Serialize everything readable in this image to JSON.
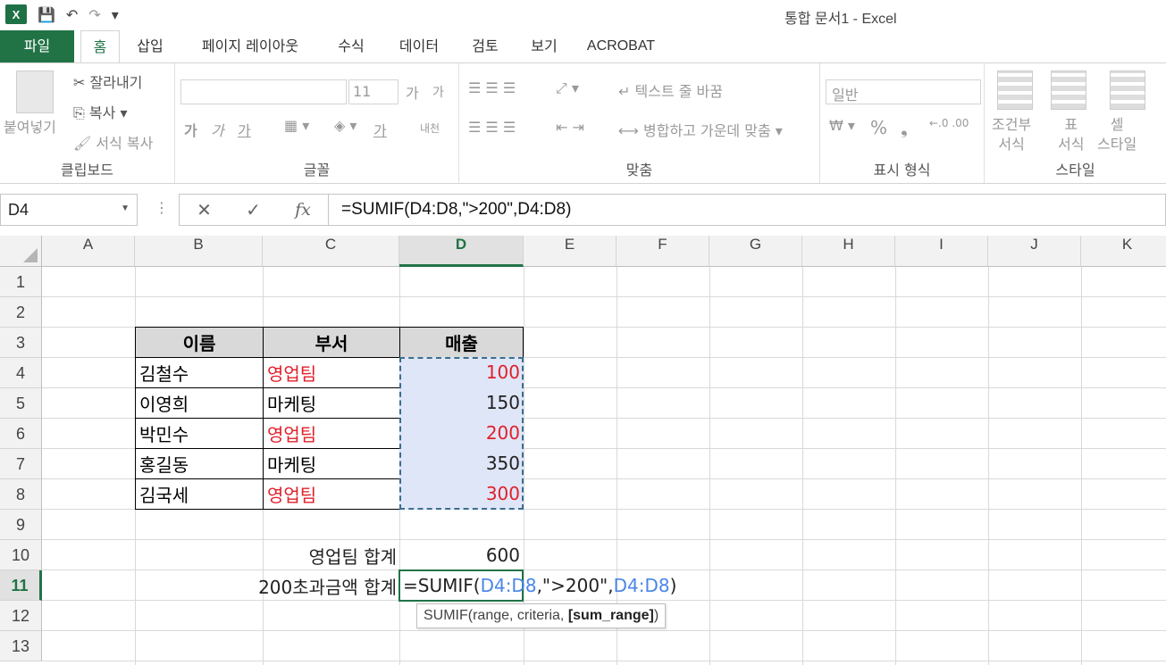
{
  "window": {
    "title": "통합 문서1 - Excel"
  },
  "qat": {
    "excel_logo": "X",
    "save_icon": "💾",
    "undo_icon": "↶",
    "redo_icon": "↷",
    "more_icon": "▾"
  },
  "tabs": [
    {
      "label": "파일"
    },
    {
      "label": "홈"
    },
    {
      "label": "삽입"
    },
    {
      "label": "페이지 레이아웃"
    },
    {
      "label": "수식"
    },
    {
      "label": "데이터"
    },
    {
      "label": "검토"
    },
    {
      "label": "보기"
    },
    {
      "label": "ACROBAT"
    }
  ],
  "ribbon": {
    "clipboard": {
      "label": "클립보드",
      "paste": "붙여넣기",
      "cut": "잘라내기",
      "copy": "복사",
      "format_painter": "서식 복사"
    },
    "font": {
      "label": "글꼴",
      "font_size": "11",
      "grow": "가",
      "shrink": "가",
      "bold": "가",
      "italic": "가",
      "underline": "가",
      "font_color": "가",
      "phonetic": "내천"
    },
    "alignment": {
      "label": "맞춤",
      "wrap_text": "텍스트 줄 바꿈",
      "merge_center": "병합하고 가운데 맞춤"
    },
    "number": {
      "label": "표시 형식",
      "format": "일반",
      "percent": "%",
      "comma": "❟"
    },
    "styles": {
      "label": "스타일",
      "conditional": "조건부\n서식",
      "table": "표\n서식",
      "cell": "셀\n스타일"
    }
  },
  "formula_bar": {
    "name_box": "D4",
    "formula": "=SUMIF(D4:D8,\">200\",D4:D8)",
    "cancel": "✕",
    "enter": "✓",
    "fx": "fx",
    "dots": "⋮"
  },
  "columns": [
    "A",
    "B",
    "C",
    "D",
    "E",
    "F",
    "G",
    "H",
    "I",
    "J",
    "K"
  ],
  "rows": [
    "1",
    "2",
    "3",
    "4",
    "5",
    "6",
    "7",
    "8",
    "9",
    "10",
    "11",
    "12",
    "13"
  ],
  "table": {
    "headers": [
      "이름",
      "부서",
      "매출"
    ],
    "rows": [
      {
        "name": "김철수",
        "dept": "영업팀",
        "sales": "100"
      },
      {
        "name": "이영희",
        "dept": "마케팅",
        "sales": "150"
      },
      {
        "name": "박민수",
        "dept": "영업팀",
        "sales": "200"
      },
      {
        "name": "홍길동",
        "dept": "마케팅",
        "sales": "350"
      },
      {
        "name": "김국세",
        "dept": "영업팀",
        "sales": "300"
      }
    ]
  },
  "summary": {
    "sales_total_label": "영업팀 합계",
    "sales_total_value": "600",
    "over200_label": "200초과금액 합계"
  },
  "edit": {
    "p1": "=SUMIF(",
    "ref1": "D4:D8",
    "p2": ",\">200\",",
    "ref2": "D4:D8",
    "p3": ")"
  },
  "tooltip": {
    "fn": "SUMIF(range, criteria, ",
    "bold": "[sum_range]",
    "end": ")"
  },
  "colors": {
    "excel_green": "#217346",
    "red_text": "#e0202b",
    "ref_blue": "#4a86e8",
    "selection": "#dfe6f7"
  }
}
